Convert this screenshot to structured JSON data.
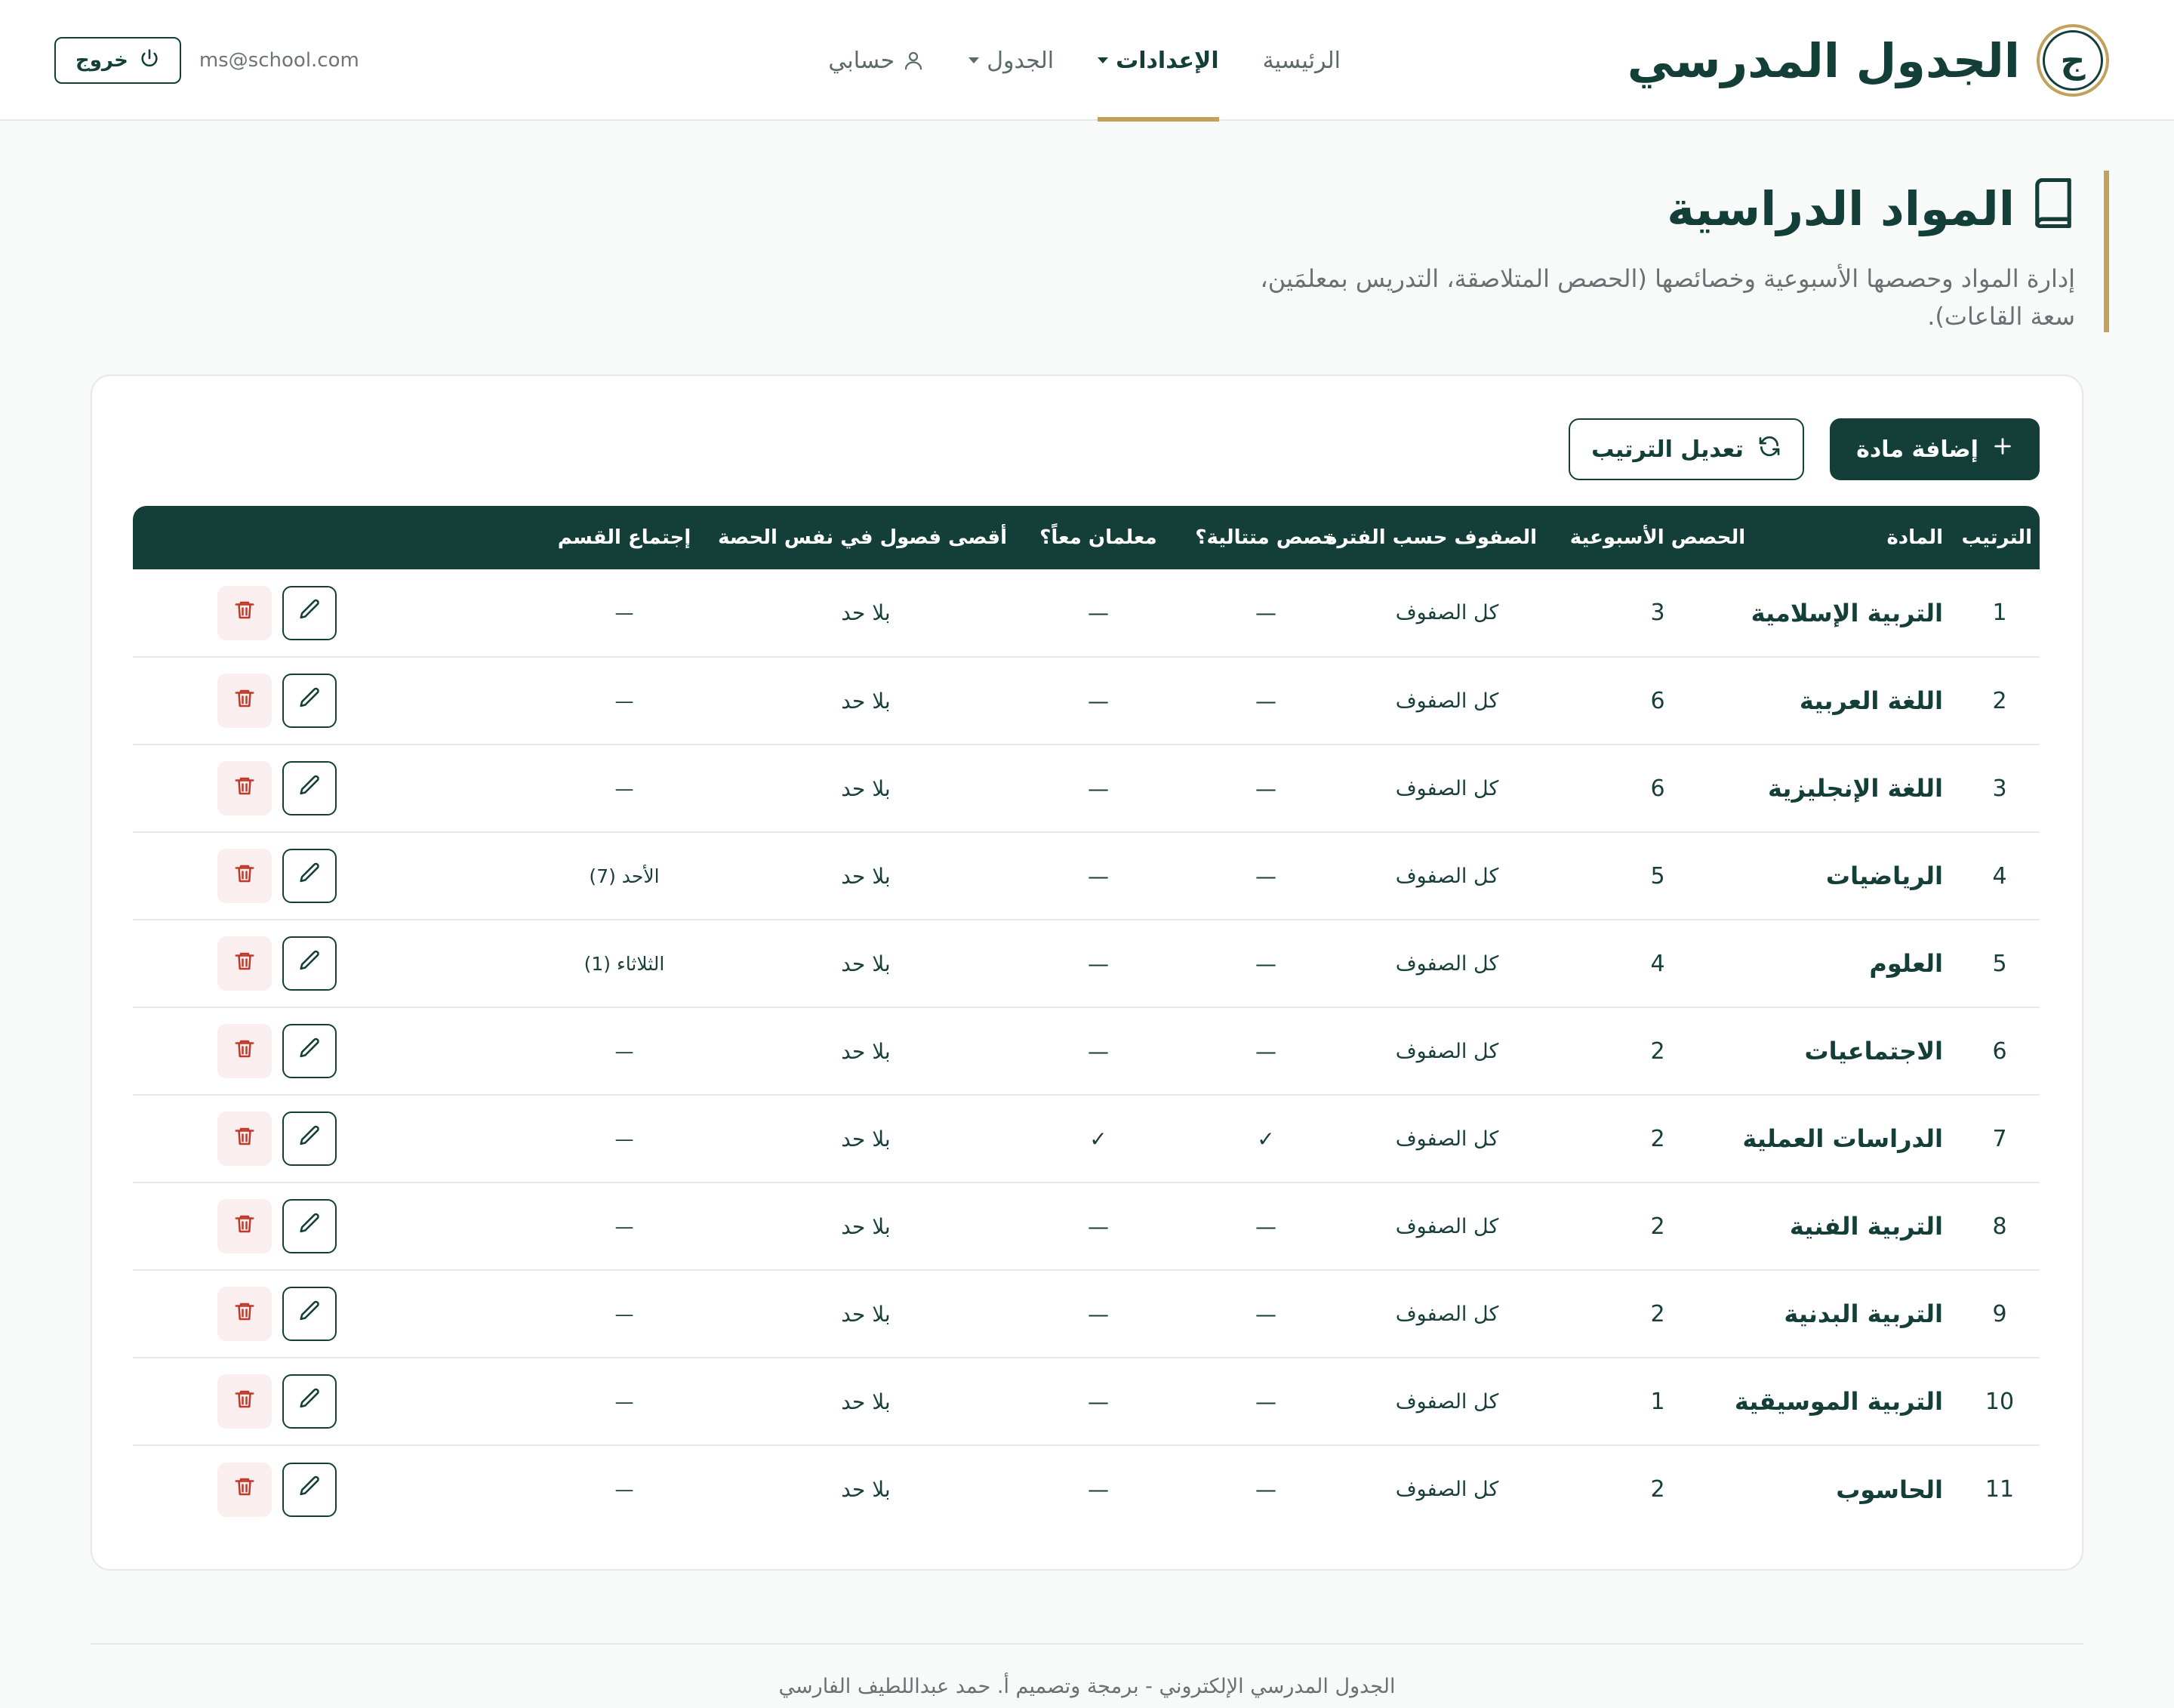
{
  "brand": {
    "title": "الجدول المدرسي",
    "logo_letter": "ج"
  },
  "nav": {
    "items": [
      {
        "label": "الرئيسية",
        "active": false,
        "has_menu": false
      },
      {
        "label": "الإعدادات",
        "active": true,
        "has_menu": true
      },
      {
        "label": "الجدول",
        "active": false,
        "has_menu": true
      },
      {
        "label": "حسابي",
        "active": false,
        "has_menu": false
      }
    ]
  },
  "account": {
    "email": "ms@school.com",
    "logout_label": "خروج"
  },
  "page": {
    "title": "المواد الدراسية",
    "description": "إدارة المواد وحصصها الأسبوعية وخصائصها (الحصص المتلاصقة، التدريس بمعلمَين، سعة القاعات)."
  },
  "toolbar": {
    "add_label": "إضافة مادة",
    "reorder_label": "تعديل الترتيب"
  },
  "table": {
    "headers": {
      "order": "الترتيب",
      "subject": "المادة",
      "weekly": "الحصص الأسبوعية",
      "classes": "الصفوف حسب الفترة",
      "consecutive": "حصص متتالية؟",
      "two_teachers": "معلمان معاً؟",
      "max_classes": "أقصى فصول في نفس الحصة",
      "meeting": "إجتماع القسم"
    },
    "rows": [
      {
        "order": "1",
        "name": "التربية الإسلامية",
        "weekly": "3",
        "classes": "كل الصفوف",
        "consecutive": "—",
        "two_teachers": "—",
        "max_classes": "بلا حد",
        "meeting": "—"
      },
      {
        "order": "2",
        "name": "اللغة العربية",
        "weekly": "6",
        "classes": "كل الصفوف",
        "consecutive": "—",
        "two_teachers": "—",
        "max_classes": "بلا حد",
        "meeting": "—"
      },
      {
        "order": "3",
        "name": "اللغة الإنجليزية",
        "weekly": "6",
        "classes": "كل الصفوف",
        "consecutive": "—",
        "two_teachers": "—",
        "max_classes": "بلا حد",
        "meeting": "—"
      },
      {
        "order": "4",
        "name": "الرياضيات",
        "weekly": "5",
        "classes": "كل الصفوف",
        "consecutive": "—",
        "two_teachers": "—",
        "max_classes": "بلا حد",
        "meeting": "الأحد (7)"
      },
      {
        "order": "5",
        "name": "العلوم",
        "weekly": "4",
        "classes": "كل الصفوف",
        "consecutive": "—",
        "two_teachers": "—",
        "max_classes": "بلا حد",
        "meeting": "الثلاثاء (1)"
      },
      {
        "order": "6",
        "name": "الاجتماعيات",
        "weekly": "2",
        "classes": "كل الصفوف",
        "consecutive": "—",
        "two_teachers": "—",
        "max_classes": "بلا حد",
        "meeting": "—"
      },
      {
        "order": "7",
        "name": "الدراسات العملية",
        "weekly": "2",
        "classes": "كل الصفوف",
        "consecutive": "✓",
        "two_teachers": "✓",
        "max_classes": "بلا حد",
        "meeting": "—"
      },
      {
        "order": "8",
        "name": "التربية الفنية",
        "weekly": "2",
        "classes": "كل الصفوف",
        "consecutive": "—",
        "two_teachers": "—",
        "max_classes": "بلا حد",
        "meeting": "—"
      },
      {
        "order": "9",
        "name": "التربية البدنية",
        "weekly": "2",
        "classes": "كل الصفوف",
        "consecutive": "—",
        "two_teachers": "—",
        "max_classes": "بلا حد",
        "meeting": "—"
      },
      {
        "order": "10",
        "name": "التربية الموسيقية",
        "weekly": "1",
        "classes": "كل الصفوف",
        "consecutive": "—",
        "two_teachers": "—",
        "max_classes": "بلا حد",
        "meeting": "—"
      },
      {
        "order": "11",
        "name": "الحاسوب",
        "weekly": "2",
        "classes": "كل الصفوف",
        "consecutive": "—",
        "two_teachers": "—",
        "max_classes": "بلا حد",
        "meeting": "—"
      }
    ]
  },
  "footer": {
    "text": "الجدول المدرسي الإلكتروني - برمجة وتصميم أ. حمد عبداللطيف الفارسي"
  },
  "colors": {
    "primary": "#133f38",
    "accent": "#c2a25a",
    "danger": "#c0392b",
    "danger_bg": "#fbeeee"
  }
}
